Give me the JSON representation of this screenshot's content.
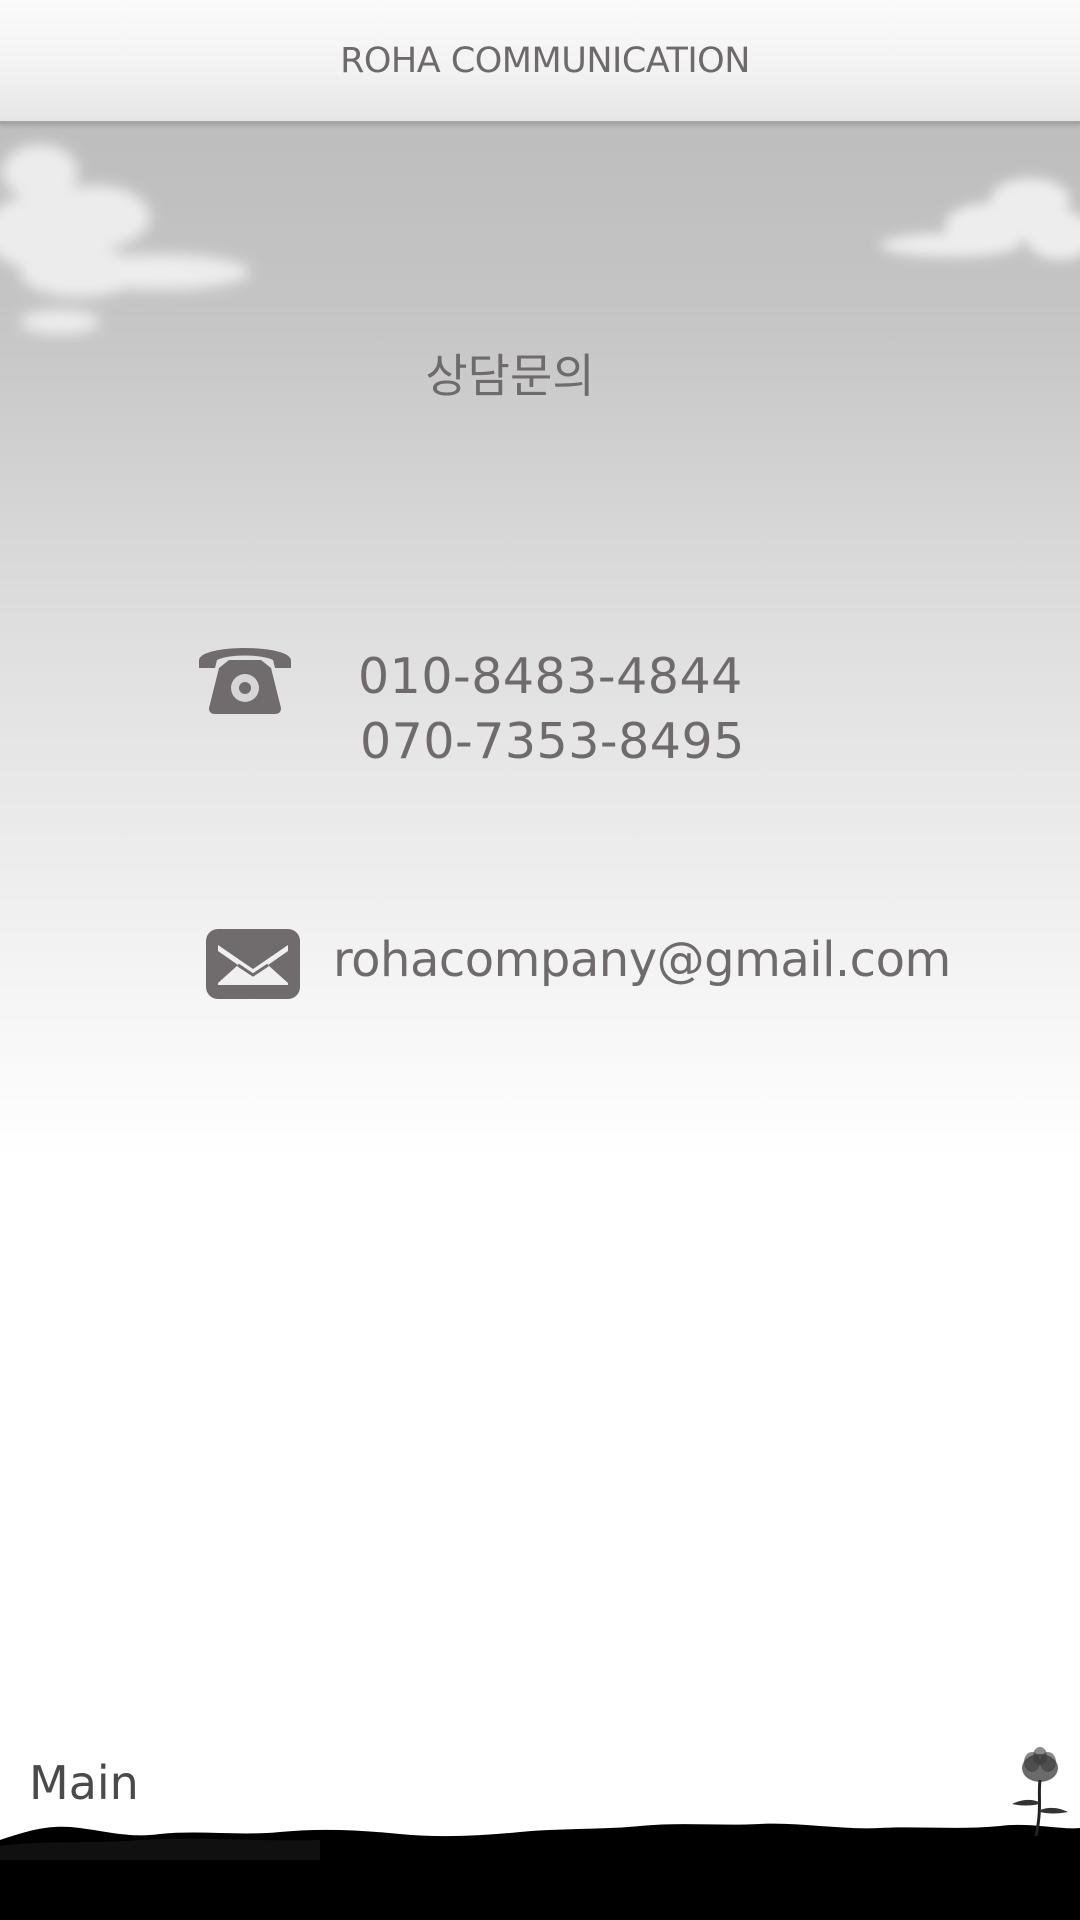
{
  "header": {
    "title": "ROHA COMMUNICATION"
  },
  "main": {
    "heading": "상담문의",
    "phones": [
      "010-8483-4844",
      "070-7353-8495"
    ],
    "email": "rohacompany@gmail.com"
  },
  "footer": {
    "main_label": "Main"
  },
  "icons": {
    "phone": "telephone-icon",
    "mail": "envelope-icon",
    "decor": [
      "cloud-left",
      "cloud-right",
      "flower-silhouette",
      "ground-silhouette"
    ]
  },
  "colors": {
    "text": "#6f6b6c",
    "icon": "#706b6c",
    "ground": "#000000"
  }
}
